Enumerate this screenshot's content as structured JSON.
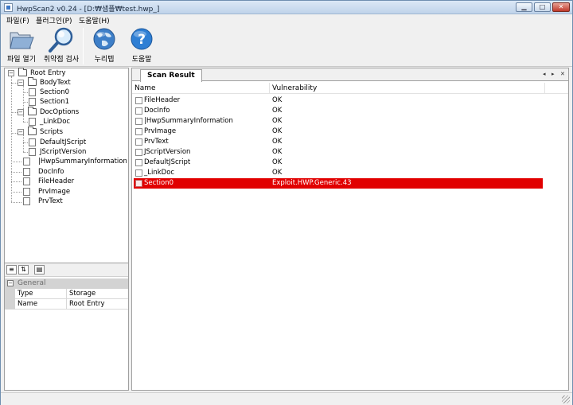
{
  "window": {
    "title": "HwpScan2 v0.24 - [D:₩샘플₩test.hwp_]",
    "min_label": "▁",
    "max_label": "□",
    "close_label": "✕"
  },
  "menu": [
    "파일(F)",
    "플러그인(P)",
    "도움말(H)"
  ],
  "toolbar": {
    "buttons": [
      {
        "label": "파일 열기",
        "icon": "folder-open-icon"
      },
      {
        "label": "취약점 검사",
        "icon": "magnifier-icon"
      },
      {
        "label": "누리텝",
        "icon": "globe-icon"
      },
      {
        "label": "도움말",
        "icon": "help-icon"
      }
    ]
  },
  "tree": {
    "root": "Root Entry",
    "nodes": [
      "BodyText",
      "Section0",
      "Section1",
      "DocOptions",
      "_LinkDoc",
      "Scripts",
      "DefaultJScript",
      "JScriptVersion",
      "|HwpSummaryInformation",
      "DocInfo",
      "FileHeader",
      "PrvImage",
      "PrvText"
    ],
    "expanders": {
      "open": "−"
    }
  },
  "properties": {
    "toolbar_glyphs": [
      "≡",
      "⇅",
      "▤"
    ],
    "category": "General",
    "category_expander": "−",
    "rows": [
      {
        "key": "Type",
        "value": "Storage"
      },
      {
        "key": "Name",
        "value": "Root Entry"
      }
    ]
  },
  "scan": {
    "tab_label": "Scan Result",
    "nav_prev": "◂",
    "nav_next": "▸",
    "nav_close": "✕",
    "columns": [
      "Name",
      "Vulnerability"
    ],
    "rows": [
      {
        "name": "FileHeader",
        "vulnerability": "OK"
      },
      {
        "name": "DocInfo",
        "vulnerability": "OK"
      },
      {
        "name": "|HwpSummaryInformation",
        "vulnerability": "OK"
      },
      {
        "name": "PrvImage",
        "vulnerability": "OK"
      },
      {
        "name": "PrvText",
        "vulnerability": "OK"
      },
      {
        "name": "JScriptVersion",
        "vulnerability": "OK"
      },
      {
        "name": "DefaultJScript",
        "vulnerability": "OK"
      },
      {
        "name": "_LinkDoc",
        "vulnerability": "OK"
      },
      {
        "name": "Section0",
        "vulnerability": "Exploit.HWP.Generic.43"
      }
    ],
    "alert_color": "#e10000"
  }
}
